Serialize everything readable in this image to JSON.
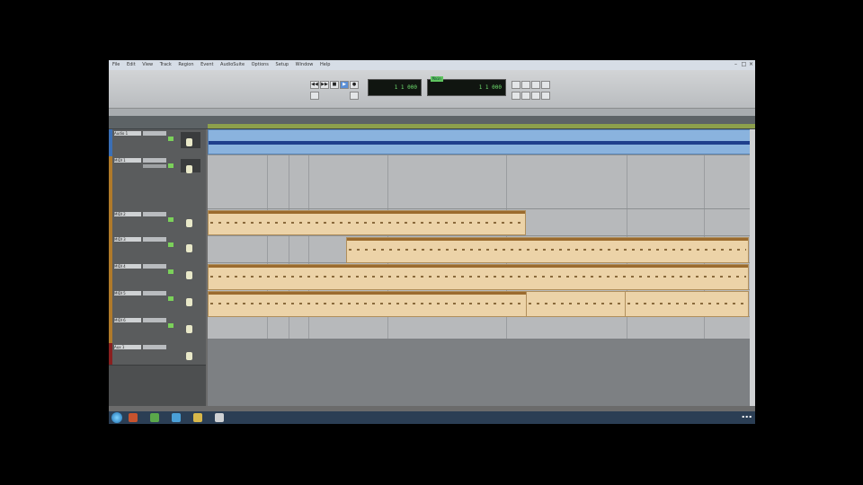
{
  "menubar": {
    "items": [
      "File",
      "Edit",
      "View",
      "Track",
      "Region",
      "Event",
      "AudioSuite",
      "Options",
      "Setup",
      "Window",
      "Help"
    ]
  },
  "window": {
    "minimize": "–",
    "maximize": "□",
    "close": "×"
  },
  "transport": {
    "buttons": [
      "◀◀",
      "▶▶",
      "■",
      "▶",
      "●"
    ],
    "main_counter": "1  1  000",
    "sub_counter": "1  1  000",
    "sub_label": "Main"
  },
  "tracks": [
    {
      "name": "Audio 1",
      "color": "#3b6fb5"
    },
    {
      "name": "MIDI 1",
      "color": "#b07a2a"
    },
    {
      "name": "MIDI 2",
      "color": "#b07a2a"
    },
    {
      "name": "MIDI 3",
      "color": "#b07a2a"
    },
    {
      "name": "MIDI 4",
      "color": "#b07a2a"
    },
    {
      "name": "MIDI 5",
      "color": "#b07a2a"
    },
    {
      "name": "MIDI 6",
      "color": "#b07a2a"
    },
    {
      "name": "Aux 1",
      "color": "#8a1f1f"
    }
  ],
  "tray": {
    "time": "",
    "icons": [
      "network-icon",
      "volume-icon",
      "flag-icon"
    ]
  },
  "colors": {
    "midi_region": "#ecd3a8",
    "audio_region": "#8ab3de",
    "ruler_accent": "#8da04c",
    "counter_text": "#6fe06f"
  }
}
